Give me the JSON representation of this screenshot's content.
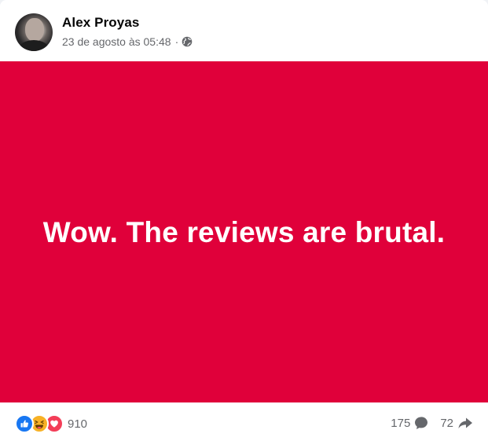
{
  "post": {
    "author": "Alex Proyas",
    "timestamp": "23 de agosto às 05:48",
    "separator": "·",
    "audience_icon": "globe-icon",
    "banner_text": "Wow. The reviews are brutal.",
    "banner_color": "#e0003a"
  },
  "footer": {
    "reaction_icons": [
      "like-icon",
      "haha-icon",
      "love-icon"
    ],
    "reaction_count": "910",
    "comment_count": "175",
    "share_count": "72"
  }
}
